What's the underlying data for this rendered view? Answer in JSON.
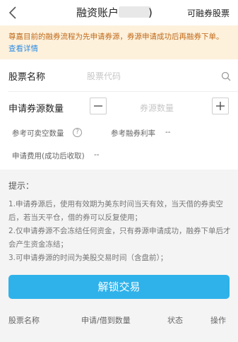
{
  "header": {
    "title": "融资账户",
    "title_suffix": ")",
    "right_link": "可融券股票"
  },
  "notice": {
    "text": "尊嘉目前的融券流程为先申请券源，券源申请成功后再融券下单。",
    "link": "查看详情"
  },
  "form": {
    "stock_label": "股票名称",
    "stock_placeholder": "股票代码",
    "quantity_label": "申请券源数量",
    "quantity_placeholder": "券源数量",
    "ref_sellable_label": "参考可卖空数量",
    "ref_rate_label": "参考融券利率",
    "ref_rate_value": "--",
    "fee_label": "申请费用(成功后收取)",
    "fee_value": "--"
  },
  "tips": {
    "title": "提示：",
    "items": [
      "1.申请券源后，使用有效期为美东时间当天有效，当天借的券卖空后，若当天平仓，借的券可以反复使用；",
      "2.仅申请券源不会冻结任何资金，只有券源申请成功，融券下单后才会产生资金冻结；",
      "3.可申请券源的时间为美股交易时间（含盘前）；"
    ]
  },
  "unlock_button": "解锁交易",
  "table": {
    "columns": [
      "股票名称",
      "申请/借到数量",
      "状态",
      "操作"
    ]
  },
  "colors": {
    "accent": "#2fb2ea",
    "notice_bg": "#fdf1dc",
    "notice_text": "#c06a1a",
    "link": "#2f8de4"
  }
}
